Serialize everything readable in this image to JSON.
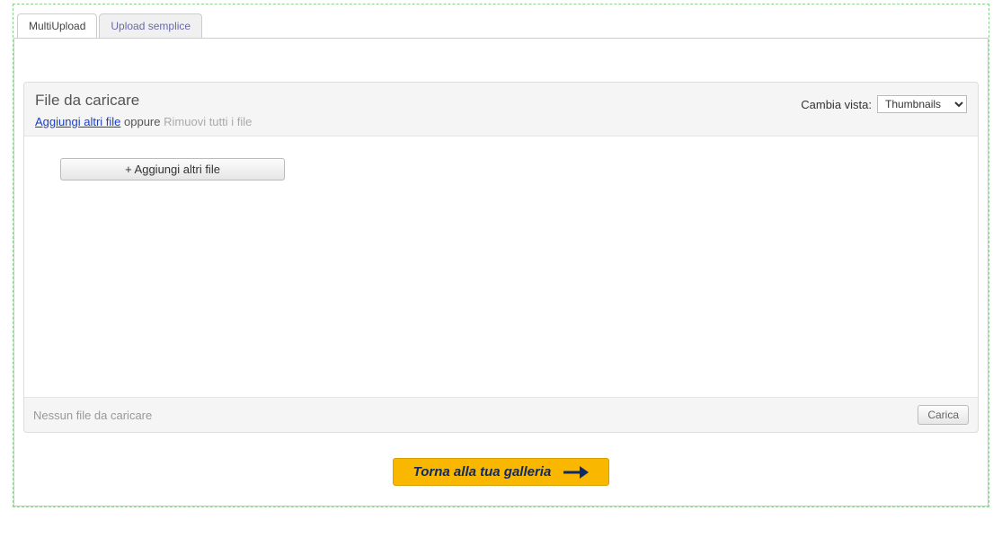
{
  "tabs": {
    "multi": "MultiUpload",
    "simple": "Upload semplice"
  },
  "panel": {
    "title": "File da caricare",
    "add_link": "Aggiungi altri file",
    "sep": "oppure",
    "remove_link": "Rimuovi tutti i file",
    "view_label": "Cambia vista:",
    "view_selected": "Thumbnails",
    "add_button": "+ Aggiungi altri file",
    "status": "Nessun file da caricare",
    "upload_button": "Carica"
  },
  "gallery_button": "Torna alla tua galleria"
}
